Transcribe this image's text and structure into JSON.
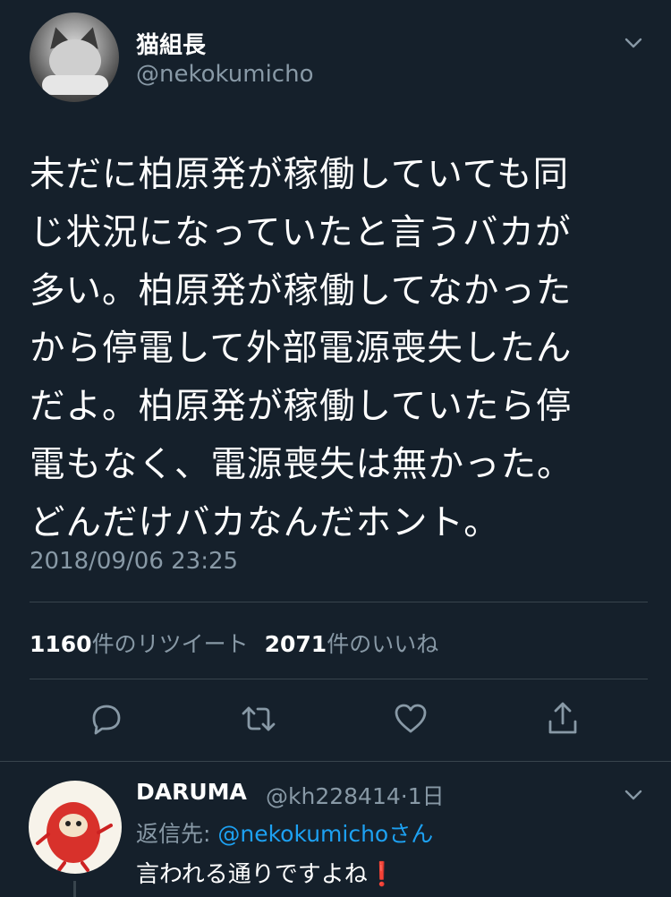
{
  "tweet": {
    "author_name": "猫組長",
    "author_handle": "@nekokumicho",
    "text": "未だに柏原発が稼働していても同\nじ状況になっていたと言うバカが\n多い。柏原発が稼働してなかった\nから停電して外部電源喪失したん\nだよ。柏原発が稼働していたら停\n電もなく、電源喪失は無かった。\nどんだけバカなんだホント。",
    "timestamp": "2018/09/06 23:25",
    "retweet_count": "1160",
    "retweet_label": "件のリツイート",
    "like_count": "2071",
    "like_label": "件のいいね"
  },
  "actions": [
    {
      "icon": "reply-icon"
    },
    {
      "icon": "retweet-icon"
    },
    {
      "icon": "like-icon"
    },
    {
      "icon": "share-icon"
    }
  ],
  "reply": {
    "author_name": "DARUMA",
    "author_handle": "@kh228414",
    "age": "1日",
    "reply_prefix": "返信先: ",
    "reply_to_handle": "@nekokumicho",
    "reply_suffix": "さん",
    "text": "言われる通りですよね",
    "text_emoji": "❗"
  },
  "colors": {
    "background": "#15202b",
    "secondary_text": "#8899a6",
    "accent": "#1da1f2",
    "divider": "#38444d"
  }
}
